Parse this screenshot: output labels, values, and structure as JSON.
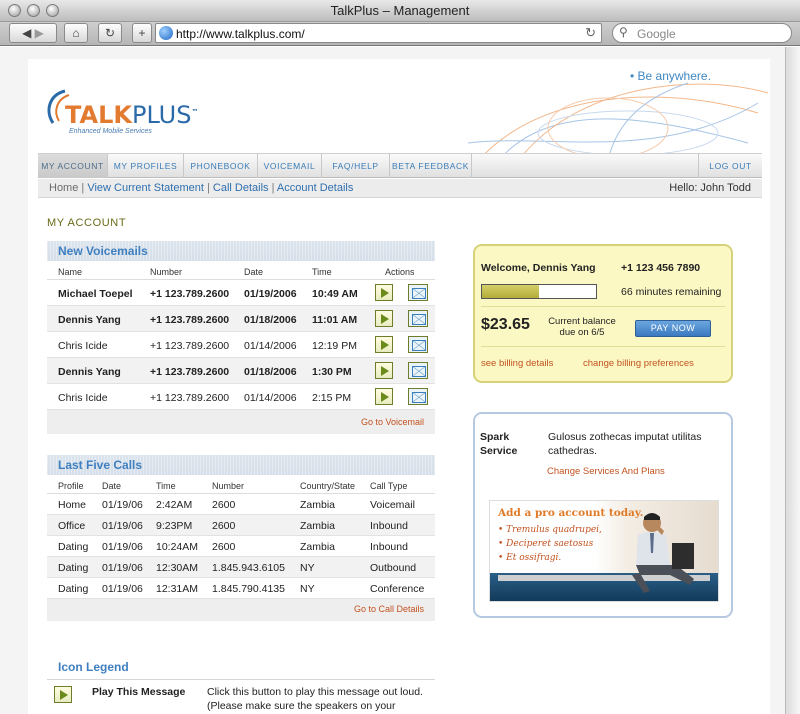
{
  "window": {
    "title": "TalkPlus – Management"
  },
  "toolbar": {
    "back_icon": "back-arrow-icon",
    "forward_icon": "forward-arrow-icon",
    "url": "http://www.talkplus.com/",
    "search_placeholder": "Google"
  },
  "header": {
    "logo_text_main": "TALK",
    "logo_text_plus": "PLUS",
    "logo_tm": "™",
    "logo_sub": "Enhanced Mobile Services",
    "tagline": "• Be anywhere."
  },
  "nav": {
    "items": [
      "MY ACCOUNT",
      "MY PROFILES",
      "PHONEBOOK",
      "VOICEMAIL",
      "FAQ/HELP",
      "BETA FEEDBACK"
    ],
    "logout": "LOG OUT"
  },
  "subnav": {
    "home": "Home",
    "sep": "|",
    "links": [
      "View Current Statement",
      "Call Details",
      "Account Details"
    ],
    "hello": "Hello: John Todd"
  },
  "page_title": "MY ACCOUNT",
  "voicemail": {
    "title": "New Voicemails",
    "columns": [
      "Name",
      "Number",
      "Date",
      "Time",
      "Actions"
    ],
    "rows": [
      {
        "name": "Michael Toepel",
        "number": "+1 123.789.2600",
        "date": "01/19/2006",
        "time": "10:49 AM",
        "bold": true
      },
      {
        "name": "Dennis Yang",
        "number": "+1 123.789.2600",
        "date": "01/18/2006",
        "time": "11:01 AM",
        "bold": true
      },
      {
        "name": "Chris Icide",
        "number": "+1 123.789.2600",
        "date": "01/14/2006",
        "time": "12:19 PM",
        "bold": false
      },
      {
        "name": "Dennis Yang",
        "number": "+1 123.789.2600",
        "date": "01/18/2006",
        "time": "1:30 PM",
        "bold": true
      },
      {
        "name": "Chris Icide",
        "number": "+1 123.789.2600",
        "date": "01/14/2006",
        "time": "2:15 PM",
        "bold": false
      }
    ],
    "footer_link": "Go to Voicemail"
  },
  "calls": {
    "title": "Last Five Calls",
    "columns": [
      "Profile",
      "Date",
      "Time",
      "Number",
      "Country/State",
      "Call Type"
    ],
    "rows": [
      {
        "profile": "Home",
        "date": "01/19/06",
        "time": "2:42AM",
        "number": "2600",
        "country": "Zambia",
        "type": "Voicemail"
      },
      {
        "profile": "Office",
        "date": "01/19/06",
        "time": "9:23PM",
        "number": "2600",
        "country": "Zambia",
        "type": "Inbound"
      },
      {
        "profile": "Dating",
        "date": "01/19/06",
        "time": "10:24AM",
        "number": "2600",
        "country": "Zambia",
        "type": "Inbound"
      },
      {
        "profile": "Dating",
        "date": "01/19/06",
        "time": "12:30AM",
        "number": "1.845.943.6105",
        "country": "NY",
        "type": "Outbound"
      },
      {
        "profile": "Dating",
        "date": "01/19/06",
        "time": "12:31AM",
        "number": "1.845.790.4135",
        "country": "NY",
        "type": "Conference"
      }
    ],
    "footer_link": "Go to Call Details"
  },
  "legend": {
    "title": "Icon Legend",
    "play_name": "Play This Message",
    "play_desc": "Click this button to play this message out loud. (Please make sure the speakers on your computer are adjusted.)"
  },
  "account": {
    "welcome": "Welcome, Dennis Yang",
    "phone": "+1 123 456 7890",
    "minutes_used_fraction": 0.5,
    "minutes": "66 minutes remaining",
    "amount": "$23.65",
    "due_line1": "Current balance",
    "due_line2": "due on 6/5",
    "pay": "PAY NOW",
    "link_billing": "see billing details",
    "link_prefs": "change billing preferences"
  },
  "spark": {
    "label_line1": "Spark",
    "label_line2": "Service",
    "desc": "Gulosus zothecas imputat utilitas cathedras.",
    "change": "Change Services And Plans",
    "promo_title": "Add a pro account today.",
    "promo_items": [
      "• Tremulus quadrupei,",
      "• Deciperet saetosus",
      "• Et ossifragi."
    ]
  },
  "colors": {
    "accent_blue": "#3f7fc0",
    "link_orange": "#c2521f",
    "account_yellow": "#fbf8c4"
  }
}
